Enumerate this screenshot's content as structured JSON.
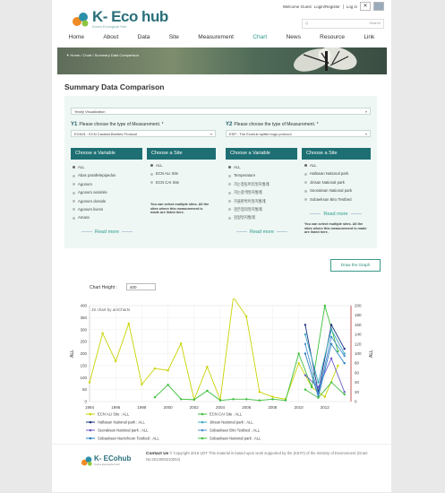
{
  "header": {
    "logo_text": "K- Eco hub",
    "logo_sub": "Korea Ecological Hub",
    "welcome": "Welcome Guest",
    "login": "Login/Register",
    "login2": "Log in",
    "search_placeholder": "Q",
    "search_button": "Search"
  },
  "nav": [
    "Home",
    "About",
    "Data",
    "Site",
    "Measurement",
    "Chart",
    "News",
    "Resource",
    "Link"
  ],
  "nav_active": "Chart",
  "breadcrumb": "Home / Chart / Summary Data Comparison",
  "page_title": "Summary Data Comparison",
  "visualization": "Yearly Visualization",
  "y1": {
    "tag": "Y1",
    "prompt": "Please choose the type of Measurement. *",
    "measurement": "ECN01 : ECN Carabid Beetles Protocol",
    "variable_header": "Choose a Variable",
    "variables": [
      "ALL",
      "Abax parallelepipedus",
      "Agonum",
      "Agonum assimile",
      "Agonum dorsale",
      "Agonum livens",
      "Amara"
    ],
    "site_header": "Choose a Site",
    "sites": [
      "ALL",
      "ECN ALI Site",
      "ECN CAI Site"
    ],
    "note": "You can select multiple sites. All the sites where this measurement is made are listed here.",
    "read_more": "Read more"
  },
  "y2": {
    "tag": "Y2",
    "prompt": "Please choose the type of Measurement. *",
    "measurement": "ESP : The Ecohub spittle bugs protocol",
    "variable_header": "Choose a Variable",
    "variables": [
      "ALL",
      "Temperature",
      "가는청동머리멋지벌레",
      "가는갈색멋지벌레",
      "가을판박이멋지벌레",
      "검은점의멋지벌레",
      "검정멋지벌레"
    ],
    "site_header": "Choose a Site",
    "sites": [
      "ALL",
      "Hallasan National park",
      "Jirisan National park",
      "Seoraksan National park",
      "Sobaeksan Biro Testbed"
    ],
    "note": "You can select multiple sites. All the sites where this measurement is made are listed here.",
    "read_more": "Read more"
  },
  "draw_button": "Draw the Graph",
  "chart_height_label": "Chart Height :",
  "chart_height_value": "400",
  "chart_data": {
    "type": "line",
    "credit": "JS chart by amCharts",
    "x_ticks": [
      "1994",
      "1996",
      "1998",
      "2000",
      "2002",
      "2004",
      "2006",
      "2008",
      "2010",
      "2012"
    ],
    "xlim": [
      1994,
      2014
    ],
    "ylabel_left": "ALL",
    "ylabel_right": "ALL",
    "ylim_left": [
      0,
      400
    ],
    "ylim_right": [
      0,
      200
    ],
    "yticks_left": [
      "0",
      "50",
      "100",
      "150",
      "200",
      "250",
      "300",
      "350",
      "400"
    ],
    "yticks_right": [
      "0",
      "20",
      "40",
      "60",
      "80",
      "100",
      "120",
      "140",
      "160",
      "180",
      "200"
    ],
    "series": [
      {
        "name": "ECN ALI Site : ALL",
        "axis": "left",
        "color": "#c9d300",
        "x": [
          1994,
          1995,
          1996,
          1997,
          1998,
          1999,
          2000,
          2001,
          2002,
          2003,
          2004,
          2005,
          2006,
          2007,
          2008,
          2009,
          2010,
          2011,
          2012,
          2013
        ],
        "y": [
          80,
          285,
          168,
          325,
          72,
          138,
          130,
          242,
          8,
          145,
          8,
          435,
          355,
          40,
          20,
          10,
          160,
          60,
          20,
          150
        ]
      },
      {
        "name": "ECN CAI Site : ALL",
        "axis": "left",
        "color": "#3cbf3c",
        "x": [
          1999,
          2000,
          2001,
          2002,
          2003,
          2004,
          2005,
          2006,
          2007,
          2008,
          2009,
          2010,
          2011,
          2012,
          2013
        ],
        "y": [
          18,
          70,
          10,
          8,
          45,
          5,
          10,
          10,
          5,
          10,
          5,
          200,
          60,
          400,
          210
        ]
      },
      {
        "name": "Hallasan National park : ALL",
        "axis": "right",
        "color": "#1a2f80",
        "x": [
          2010.5,
          2011.5,
          2012.5,
          2013.5
        ],
        "y": [
          160,
          20,
          160,
          110
        ]
      },
      {
        "name": "Jirisan National park : ALL",
        "axis": "right",
        "color": "#3aaac0",
        "x": [
          2010.5,
          2011.5,
          2012.5,
          2013.5
        ],
        "y": [
          140,
          40,
          150,
          100
        ]
      },
      {
        "name": "Seoraksan National park : ALL",
        "axis": "right",
        "color": "#6b5cc8",
        "x": [
          2010.5,
          2011.5,
          2012.5,
          2013.5
        ],
        "y": [
          55,
          30,
          90,
          20
        ]
      },
      {
        "name": "Sobaeksan Biro Testbed : ALL",
        "axis": "right",
        "color": "#4a90d0",
        "x": [
          2010.5,
          2011.5,
          2012.5,
          2013.5
        ],
        "y": [
          120,
          15,
          135,
          95
        ]
      },
      {
        "name": "Sobaeksan Namcheon Testbed : ALL",
        "axis": "right",
        "color": "#2a80c0",
        "x": [
          2010.5,
          2011.5,
          2012.5,
          2013.5
        ],
        "y": [
          100,
          10,
          120,
          80
        ]
      },
      {
        "name": "Sobaeksan National park : ALL",
        "axis": "right",
        "color": "#40c040",
        "x": [
          2010.5,
          2011.5,
          2012.5,
          2013.5
        ],
        "y": [
          25,
          8,
          40,
          15
        ]
      }
    ]
  },
  "footer": {
    "logo_text": "K- ECohub",
    "logo_sub": "Korea Ecological Hub",
    "contact": "Contact Us",
    "copyright": "© Copyright 2016 UDT This material is based upon work supported by the (KEITI) of the ministry of Environment (Grant No:2014000210004)"
  }
}
